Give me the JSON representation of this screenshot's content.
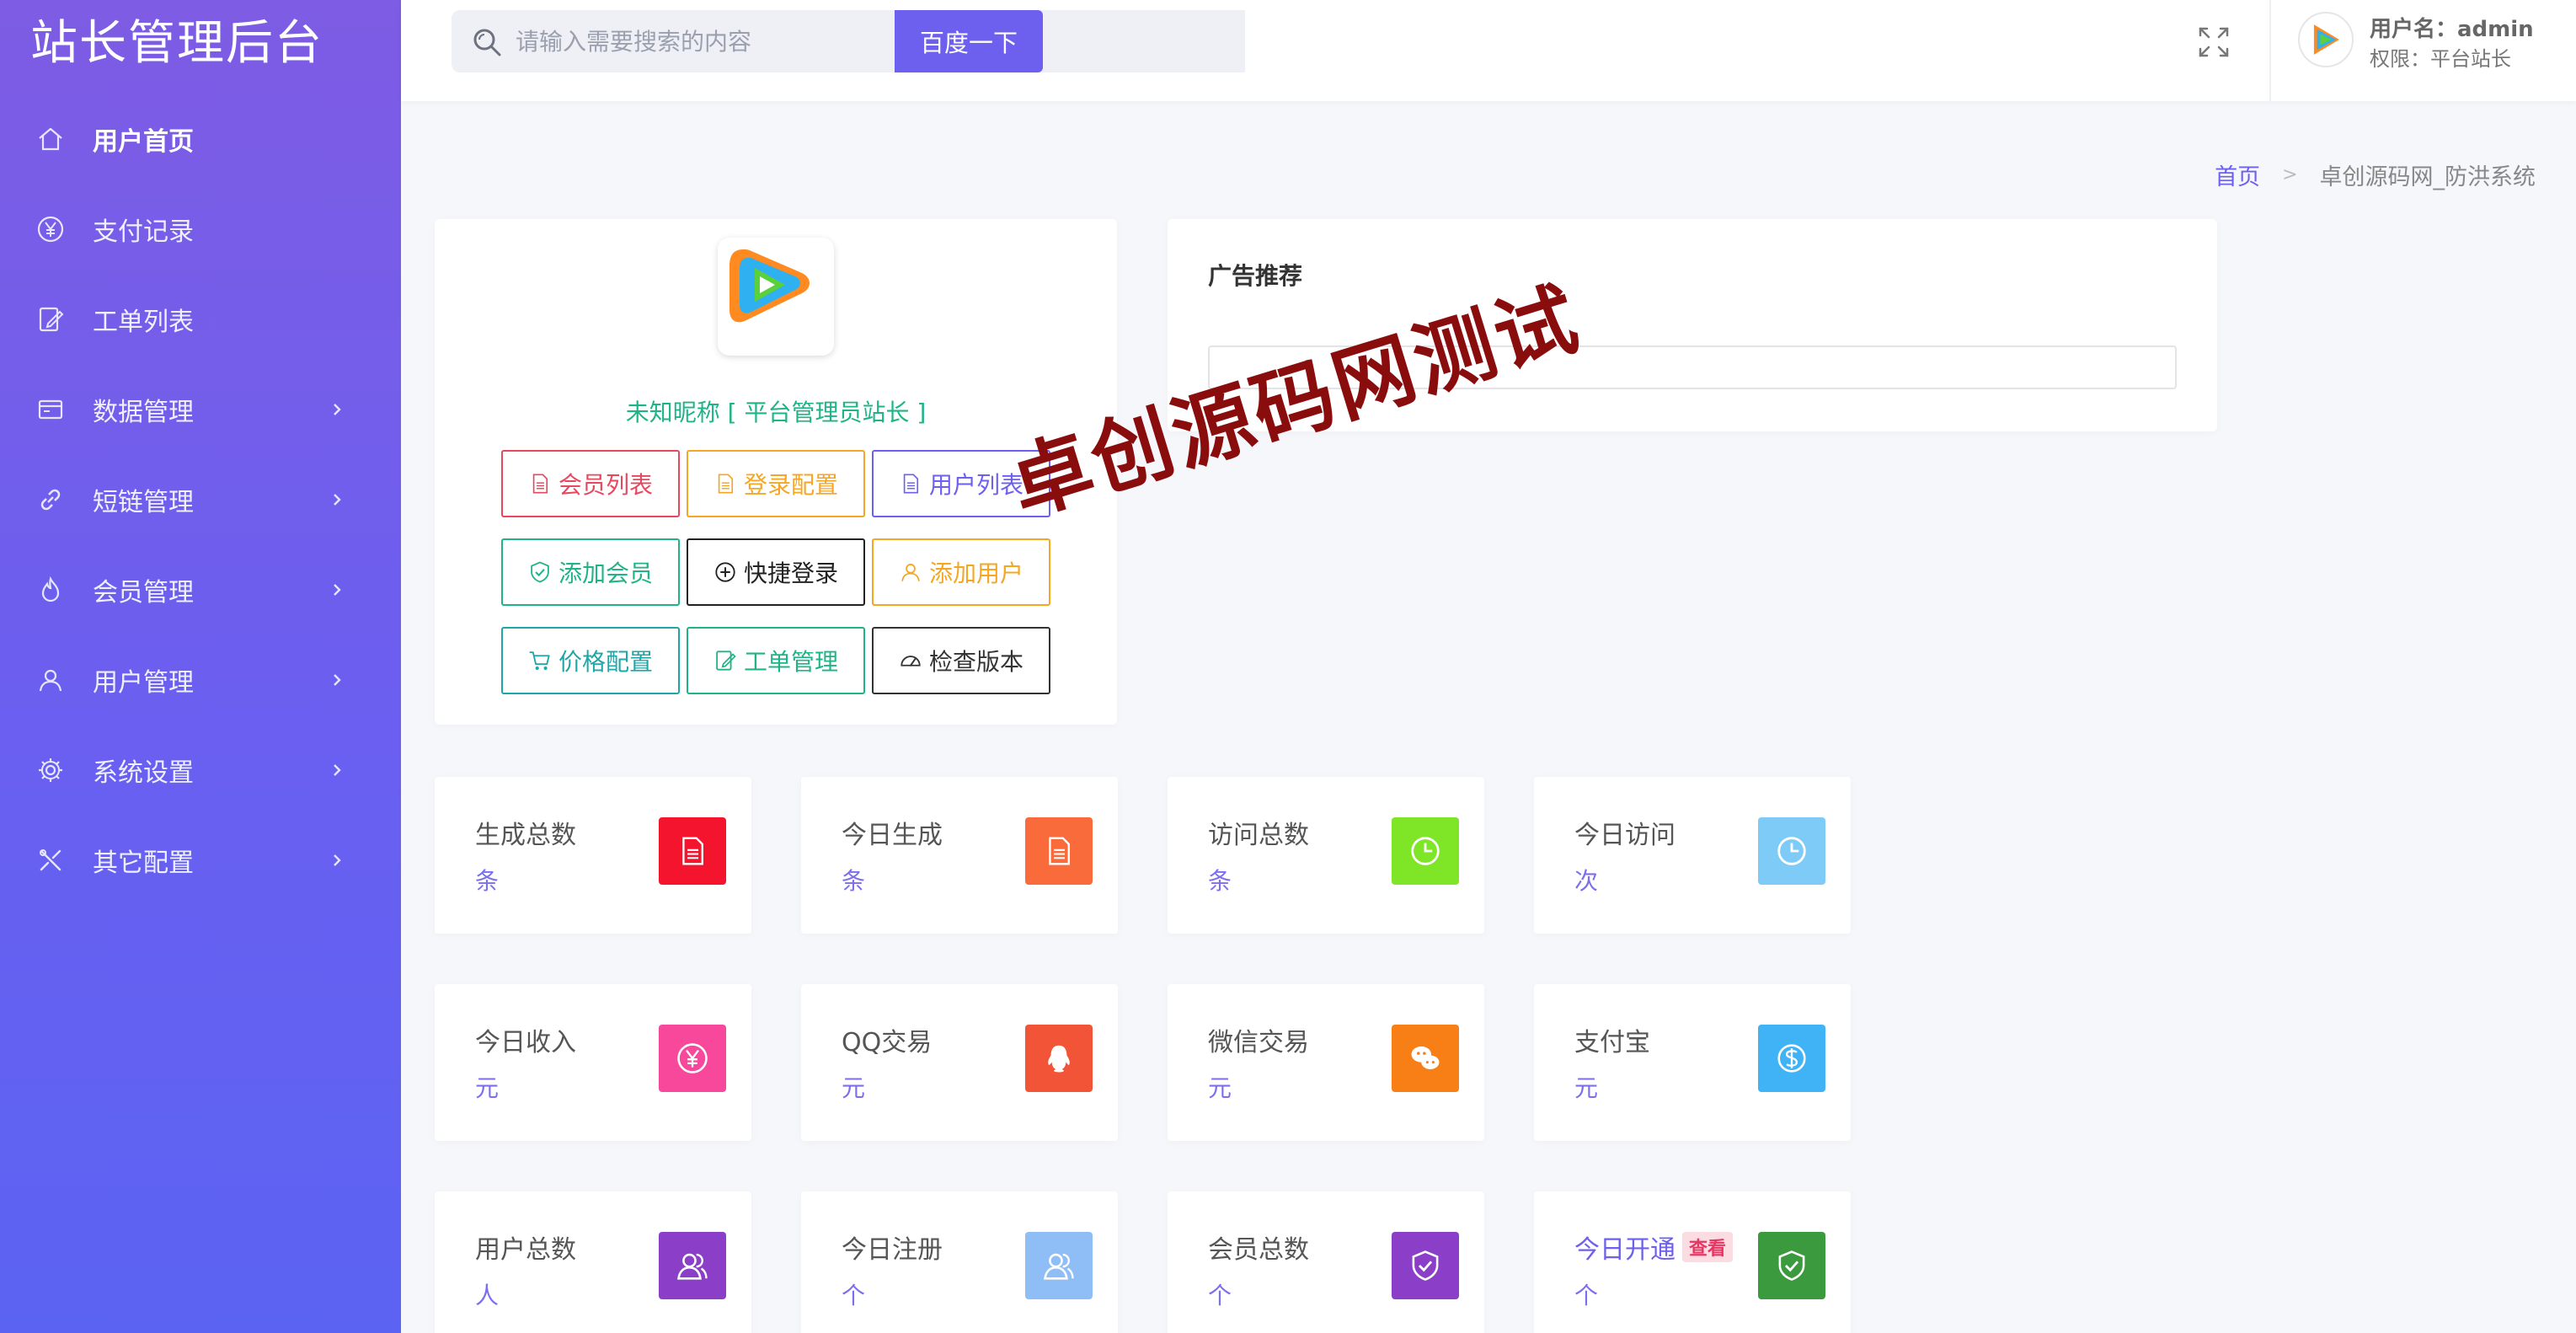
{
  "sidebar": {
    "brand": "站长管理后台",
    "items": [
      {
        "label": "用户首页",
        "icon": "home-icon",
        "active": true
      },
      {
        "label": "支付记录",
        "icon": "yen-circle-icon"
      },
      {
        "label": "工单列表",
        "icon": "edit-doc-icon"
      },
      {
        "label": "数据管理",
        "icon": "database-card-icon",
        "has_sub": true
      },
      {
        "label": "短链管理",
        "icon": "link-icon",
        "has_sub": true
      },
      {
        "label": "会员管理",
        "icon": "flame-icon",
        "has_sub": true
      },
      {
        "label": "用户管理",
        "icon": "user-icon",
        "has_sub": true
      },
      {
        "label": "系统设置",
        "icon": "gear-icon",
        "has_sub": true
      },
      {
        "label": "其它配置",
        "icon": "tools-icon",
        "has_sub": true
      }
    ]
  },
  "header": {
    "search_placeholder": "请输入需要搜索的内容",
    "search_button": "百度一下",
    "user_name": "用户名：admin",
    "user_role": "权限：平台站长"
  },
  "breadcrumb": {
    "home": "首页",
    "current": "卓创源码网_防洪系统"
  },
  "profile": {
    "logo_text": "腾讯视频",
    "name": "未知昵称 [ 平台管理员站长 ]",
    "buttons": [
      {
        "label": "会员列表",
        "color": "#e5485f",
        "icon": "doc-icon"
      },
      {
        "label": "登录配置",
        "color": "#f5a623",
        "icon": "doc-icon"
      },
      {
        "label": "用户列表",
        "color": "#6d60ef",
        "icon": "doc-icon"
      },
      {
        "label": "添加会员",
        "color": "#1fb487",
        "icon": "shield-check-icon"
      },
      {
        "label": "快捷登录",
        "color": "#222222",
        "icon": "plus-circle-icon"
      },
      {
        "label": "添加用户",
        "color": "#f5a623",
        "icon": "user-icon"
      },
      {
        "label": "价格配置",
        "color": "#1fa7a7",
        "icon": "cart-icon"
      },
      {
        "label": "工单管理",
        "color": "#1fb487",
        "icon": "edit-doc-icon"
      },
      {
        "label": "检查版本",
        "color": "#333333",
        "icon": "gauge-icon"
      }
    ]
  },
  "ad": {
    "title": "广告推荐"
  },
  "stats": [
    {
      "title": "生成总数",
      "unit": "条",
      "color": "#f5142d",
      "icon": "doc-icon"
    },
    {
      "title": "今日生成",
      "unit": "条",
      "color": "#fa6b3b",
      "icon": "doc-icon"
    },
    {
      "title": "访问总数",
      "unit": "条",
      "color": "#7ee627",
      "icon": "clock-icon"
    },
    {
      "title": "今日访问",
      "unit": "次",
      "color": "#7ecbf7",
      "icon": "clock-icon"
    },
    {
      "title": "今日收入",
      "unit": "元",
      "color": "#f7489c",
      "icon": "yen-circle-icon"
    },
    {
      "title": "QQ交易",
      "unit": "元",
      "color": "#f25438",
      "icon": "qq-icon"
    },
    {
      "title": "微信交易",
      "unit": "元",
      "color": "#f77f15",
      "icon": "wechat-icon"
    },
    {
      "title": "支付宝",
      "unit": "元",
      "color": "#3fb3f6",
      "icon": "dollar-circle-icon"
    },
    {
      "title": "用户总数",
      "unit": "人",
      "color": "#8b3fc9",
      "icon": "users-icon"
    },
    {
      "title": "今日注册",
      "unit": "个",
      "color": "#8fbdf5",
      "icon": "users-icon"
    },
    {
      "title": "会员总数",
      "unit": "个",
      "color": "#8b3fc9",
      "icon": "shield-check-icon"
    },
    {
      "title": "今日开通",
      "unit": "个",
      "color": "#3a9a3d",
      "icon": "shield-check-icon",
      "badge": "查看"
    }
  ],
  "watermark": "卓创源码网测试"
}
